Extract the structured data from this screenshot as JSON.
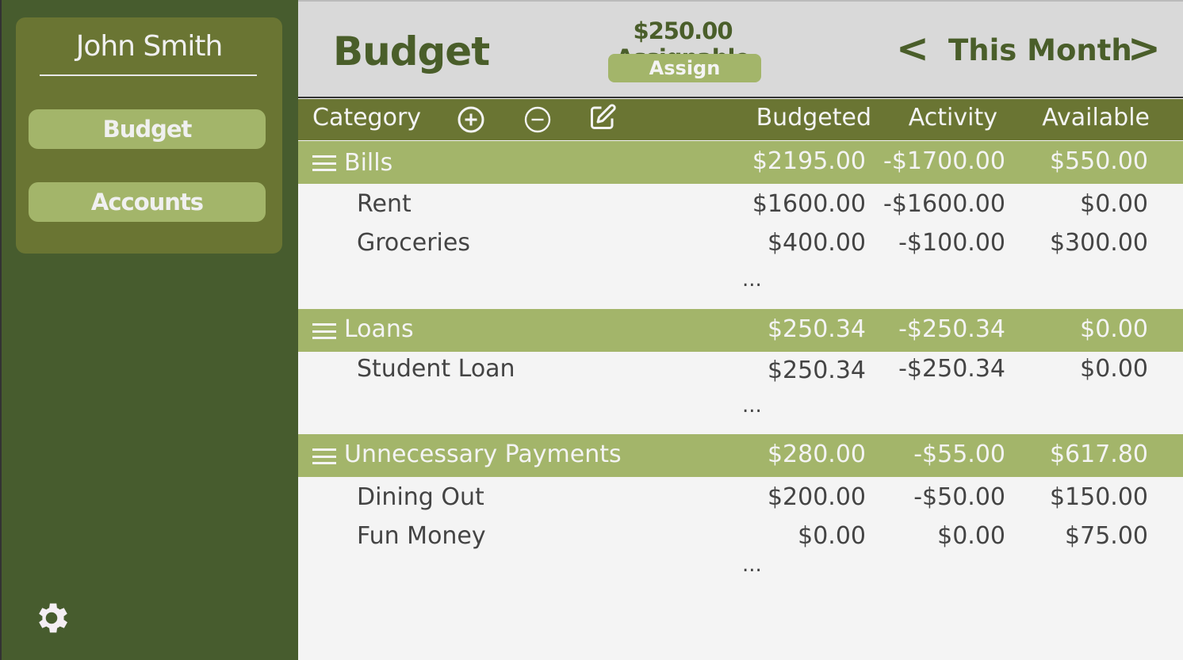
{
  "sidebar": {
    "user_name": "John Smith",
    "nav": [
      {
        "label": "Budget"
      },
      {
        "label": "Accounts"
      }
    ],
    "settings_icon": "gear-icon"
  },
  "header": {
    "title": "Budget",
    "assignable": "$250.00 Assignable",
    "assign_label": "Assign",
    "prev": "<",
    "period": "This Month",
    "next": ">"
  },
  "columns": {
    "category": "Category",
    "budgeted": "Budgeted",
    "activity": "Activity",
    "available": "Available",
    "icons": [
      "plus-circle-icon",
      "minus-circle-icon",
      "edit-icon"
    ]
  },
  "groups": [
    {
      "name": "Bills",
      "budgeted": "$2195.00",
      "activity": "-$1700.00",
      "available": "$550.00",
      "items": [
        {
          "name": "Rent",
          "budgeted": "$1600.00",
          "activity": "-$1600.00",
          "available": "$0.00"
        },
        {
          "name": "Groceries",
          "budgeted": "$400.00",
          "activity": "-$100.00",
          "available": "$300.00"
        }
      ],
      "more": "..."
    },
    {
      "name": "Loans",
      "budgeted": "$250.34",
      "activity": "-$250.34",
      "available": "$0.00",
      "items": [
        {
          "name": "Student Loan",
          "budgeted": "$250.34",
          "activity": "-$250.34",
          "available": "$0.00"
        }
      ],
      "more": "..."
    },
    {
      "name": "Unnecessary Payments",
      "budgeted": "$280.00",
      "activity": "-$55.00",
      "available": "$617.80",
      "items": [
        {
          "name": "Dining Out",
          "budgeted": "$200.00",
          "activity": "-$50.00",
          "available": "$150.00"
        },
        {
          "name": "Fun Money",
          "budgeted": "$0.00",
          "activity": "$0.00",
          "available": "$75.00"
        }
      ],
      "more": "..."
    }
  ],
  "colors": {
    "sidebar": "#475c2e",
    "panel": "#6a7533",
    "accent": "#a3b56a",
    "header": "#d9d9d9",
    "text": "#4a5e2a"
  }
}
